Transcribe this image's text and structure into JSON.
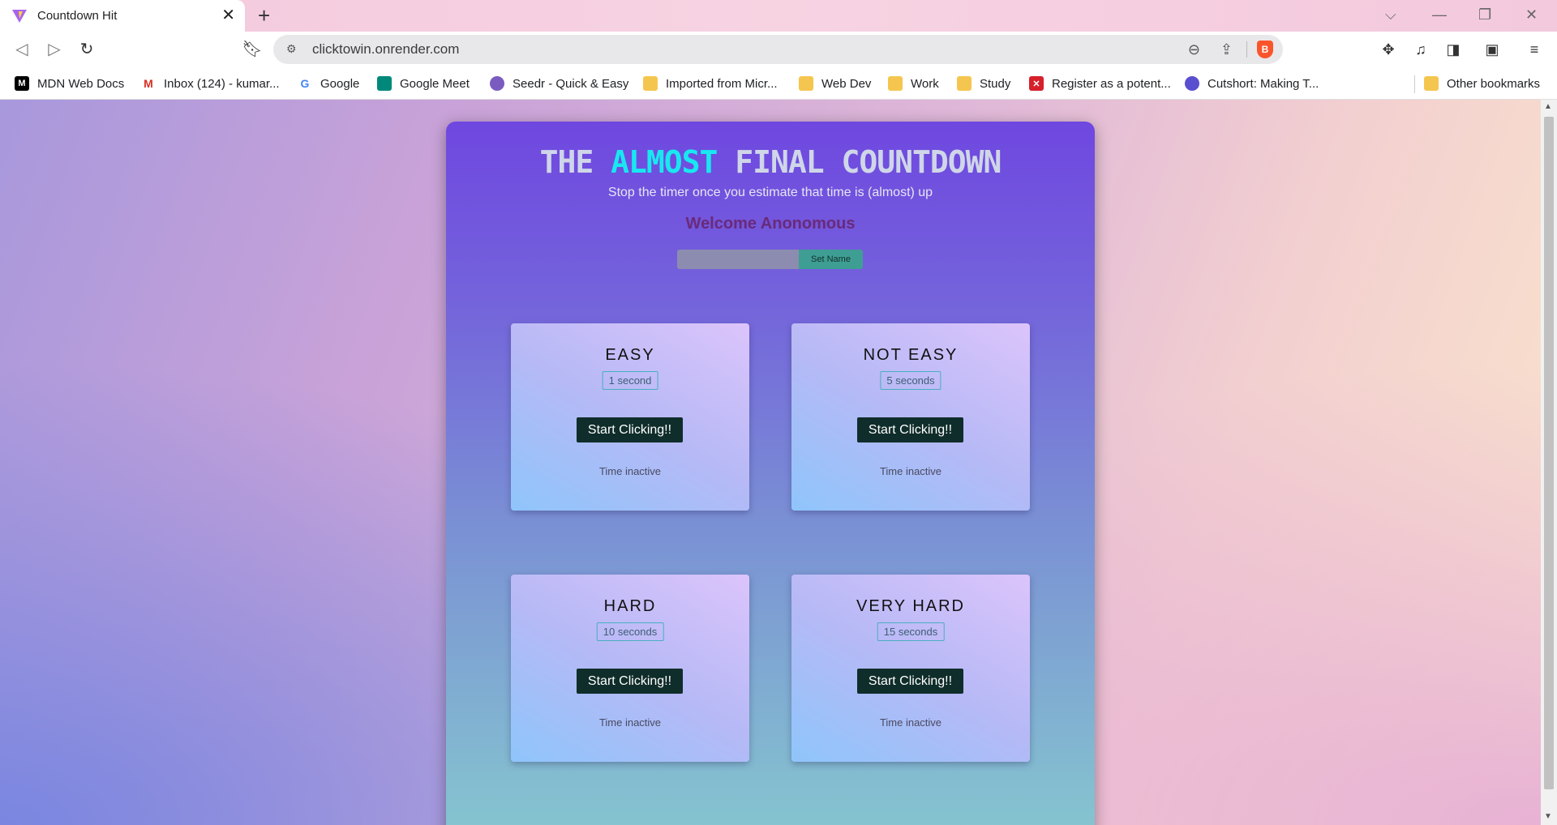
{
  "browser": {
    "tab_title": "Countdown Hit",
    "url": "clicktowin.onrender.com",
    "bookmarks": [
      {
        "label": "MDN Web Docs",
        "icon": "mdn-icon"
      },
      {
        "label": "Inbox (124) - kumar...",
        "icon": "gmail-icon"
      },
      {
        "label": "Google",
        "icon": "google-icon"
      },
      {
        "label": "Google Meet",
        "icon": "meet-icon"
      },
      {
        "label": "Seedr - Quick & Easy",
        "icon": "seedr-icon"
      },
      {
        "label": "Imported from Micr...",
        "icon": "folder-icon"
      },
      {
        "label": "Web Dev",
        "icon": "folder-icon"
      },
      {
        "label": "Work",
        "icon": "folder-icon"
      },
      {
        "label": "Study",
        "icon": "folder-icon"
      },
      {
        "label": "Register as a potent...",
        "icon": "register-icon"
      },
      {
        "label": "Cutshort: Making T...",
        "icon": "cutshort-icon"
      }
    ],
    "other_bookmarks": "Other bookmarks"
  },
  "app": {
    "title_prefix": "THE",
    "title_accent": "ALMOST",
    "title_suffix": "FINAL COUNTDOWN",
    "subtitle": "Stop the timer once you estimate that time is (almost) up",
    "welcome": "Welcome Anonomous",
    "name_input_value": "",
    "set_name_label": "Set Name",
    "accent_color": "#18e8f0"
  },
  "challenges": [
    {
      "title": "EASY",
      "duration": "1 second",
      "button": "Start Clicking!!",
      "status": "Time inactive"
    },
    {
      "title": "NOT EASY",
      "duration": "5 seconds",
      "button": "Start Clicking!!",
      "status": "Time inactive"
    },
    {
      "title": "HARD",
      "duration": "10 seconds",
      "button": "Start Clicking!!",
      "status": "Time inactive"
    },
    {
      "title": "VERY HARD",
      "duration": "15 seconds",
      "button": "Start Clicking!!",
      "status": "Time inactive"
    }
  ]
}
